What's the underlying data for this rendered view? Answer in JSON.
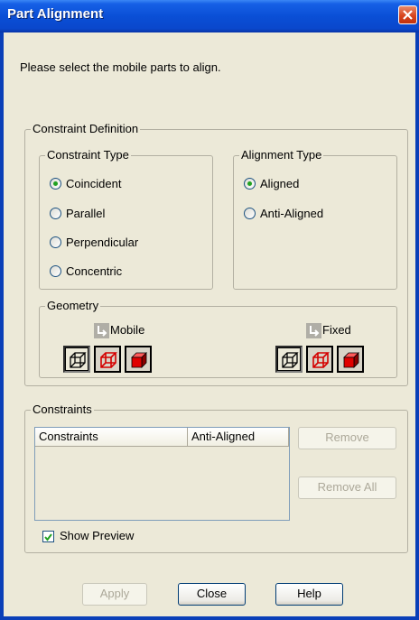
{
  "window": {
    "title": "Part Alignment"
  },
  "instruction": "Please select the mobile parts to align.",
  "constraint_definition": {
    "legend": "Constraint Definition",
    "constraint_type": {
      "legend": "Constraint Type",
      "options": [
        "Coincident",
        "Parallel",
        "Perpendicular",
        "Concentric"
      ],
      "selected": "Coincident"
    },
    "alignment_type": {
      "legend": "Alignment Type",
      "options": [
        "Aligned",
        "Anti-Aligned"
      ],
      "selected": "Aligned"
    },
    "geometry": {
      "legend": "Geometry",
      "mobile_label": "Mobile",
      "fixed_label": "Fixed"
    }
  },
  "constraints": {
    "legend": "Constraints",
    "columns": [
      "Constraints",
      "Anti-Aligned"
    ],
    "remove_label": "Remove",
    "remove_all_label": "Remove All",
    "show_preview_label": "Show Preview",
    "show_preview_checked": true
  },
  "footer": {
    "apply_label": "Apply",
    "close_label": "Close",
    "help_label": "Help"
  },
  "colors": {
    "titlebar": "#0a4fd6",
    "radio_dot": "#21a121",
    "cube_red": "#e00000"
  }
}
